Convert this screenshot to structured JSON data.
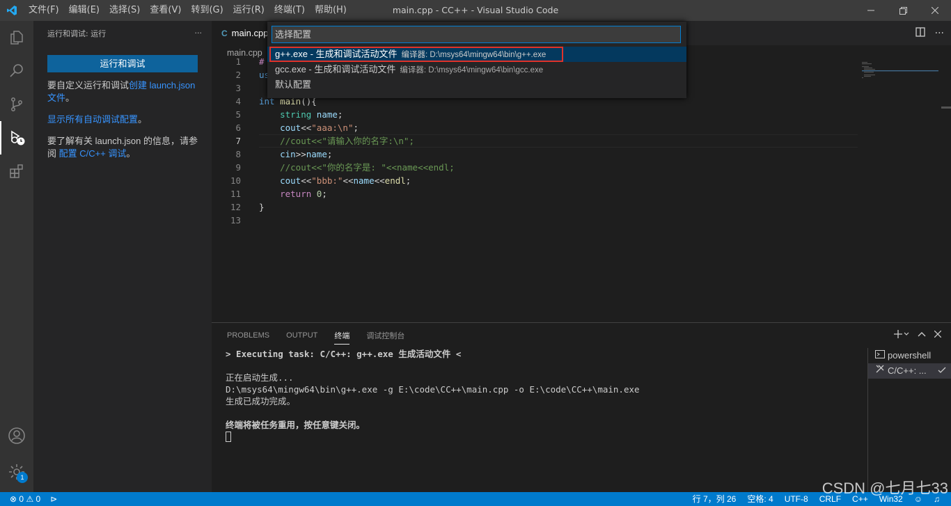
{
  "titlebar": {
    "menus": [
      "文件(F)",
      "编辑(E)",
      "选择(S)",
      "查看(V)",
      "转到(G)",
      "运行(R)",
      "终端(T)",
      "帮助(H)"
    ],
    "title": "main.cpp - CC++ - Visual Studio Code"
  },
  "activitybar": {
    "badge": "1"
  },
  "sidebar": {
    "title": "运行和调试: 运行",
    "more": "···",
    "run_button": "运行和调试",
    "p1_text": "要自定义运行和调试",
    "p1_link": "创建 launch.json 文件",
    "p1_end": "。",
    "p2_link": "显示所有自动调试配置",
    "p2_end": "。",
    "p3_text": "要了解有关 launch.json 的信息，请参阅 ",
    "p3_link": "配置 C/C++ 调试",
    "p3_end": "。"
  },
  "editor": {
    "tab_label": "main.cpp",
    "tab_icon": "C",
    "breadcrumb": "main.cpp",
    "line_numbers": [
      "1",
      "2",
      "3",
      "4",
      "5",
      "6",
      "7",
      "8",
      "9",
      "10",
      "11",
      "12",
      "13"
    ],
    "current_line": "7"
  },
  "quickpick": {
    "placeholder": "选择配置",
    "items": [
      {
        "label": "g++.exe - 生成和调试活动文件",
        "desc": "编译器: D:\\msys64\\mingw64\\bin\\g++.exe"
      },
      {
        "label": "gcc.exe - 生成和调试活动文件",
        "desc": "编译器: D:\\msys64\\mingw64\\bin\\gcc.exe"
      },
      {
        "label": "默认配置",
        "desc": ""
      }
    ]
  },
  "panel": {
    "tabs": [
      "PROBLEMS",
      "OUTPUT",
      "终端",
      "调试控制台"
    ],
    "active_tab": "终端",
    "terminal_lines": [
      "> Executing task: C/C++: g++.exe 生成活动文件 <",
      "",
      "正在启动生成...",
      "D:\\msys64\\mingw64\\bin\\g++.exe -g E:\\code\\CC++\\main.cpp -o E:\\code\\CC++\\main.exe",
      "生成已成功完成。",
      "",
      "终端将被任务重用，按任意键关闭。"
    ],
    "terminals": [
      {
        "label": "powershell"
      },
      {
        "label": "C/C++: ..."
      }
    ]
  },
  "statusbar": {
    "errors": "0",
    "warnings": "0",
    "position": "行 7，列 26",
    "spaces": "空格: 4",
    "encoding": "UTF-8",
    "eol": "CRLF",
    "language": "C++",
    "platform": "Win32"
  },
  "watermark": "CSDN @七月七33",
  "colors": {
    "accent": "#007acc",
    "highlight": "#e0322a",
    "selection": "#04395e"
  }
}
